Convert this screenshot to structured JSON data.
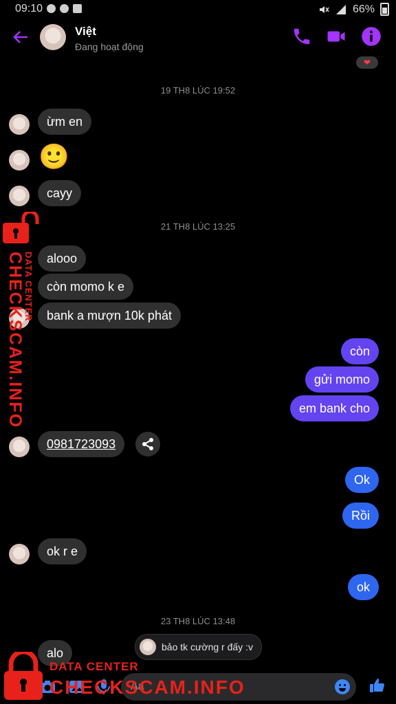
{
  "status_bar": {
    "time": "09:10",
    "battery": "66%"
  },
  "header": {
    "name": "Việt",
    "status": "Đang hoạt động"
  },
  "reaction": "❤",
  "timestamps": [
    "19 TH8 LÚC 19:52",
    "21 TH8 LÚC 13:25",
    "23 TH8 LÚC 13:48"
  ],
  "messages": {
    "m1": "ừm en",
    "m2": "🙂",
    "m3": "cayy",
    "m4": "alooo",
    "m5": "còn momo k e",
    "m6": "bank a mượn 10k phát",
    "m7": "còn",
    "m8": "gửi momo",
    "m9": "em bank cho",
    "m10": "0981723093",
    "m11": "Ok",
    "m12": "Rồi",
    "m13": "ok r e",
    "m14": "ok",
    "m15": "alo"
  },
  "reply_chip": "bảo tk cường r đấy :v",
  "composer": {
    "placeholder": "Aa"
  },
  "watermark": {
    "vertical": "CHECKSCAM.INFO",
    "vertical_small": "DATA CENTER",
    "small": "DATA CENTER",
    "big": "CHECKSCAM.INFO"
  },
  "colors": {
    "accent_purple": "#a334fa",
    "bubble_in": "#303030",
    "bubble_out_purple": "#6444f0",
    "bubble_out_blue": "#2f66f0",
    "watermark_red": "#e8221a"
  }
}
